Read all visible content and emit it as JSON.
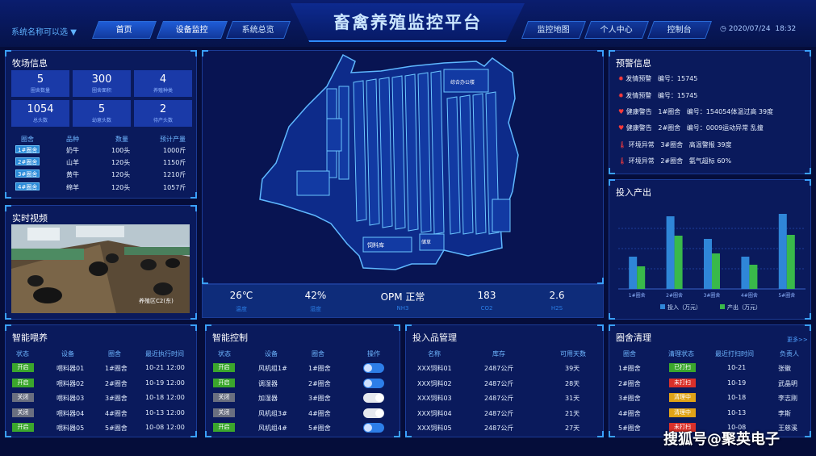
{
  "header": {
    "title": "畜禽养殖监控平台",
    "system_name": "系统名称可以选",
    "datetime_date": "2020/07/24",
    "datetime_time": "18:32",
    "nav_left": [
      "首页",
      "设备监控",
      "系统总览"
    ],
    "nav_right": [
      "监控地图",
      "个人中心",
      "控制台"
    ]
  },
  "farm_info": {
    "title": "牧场信息",
    "stats": [
      {
        "value": "5",
        "label": "圈舍数量"
      },
      {
        "value": "300",
        "label": "圈舍面积"
      },
      {
        "value": "4",
        "label": "养殖种类"
      },
      {
        "value": "1054",
        "label": "总头数"
      },
      {
        "value": "5",
        "label": "幼崽头数"
      },
      {
        "value": "2",
        "label": "待产头数"
      }
    ],
    "columns": [
      "圈舍",
      "品种",
      "数量",
      "预计产量"
    ],
    "rows": [
      [
        "1#圈舍",
        "奶牛",
        "100头",
        "1000斤"
      ],
      [
        "2#圈舍",
        "山羊",
        "120头",
        "1150斤"
      ],
      [
        "3#圈舍",
        "黄牛",
        "120头",
        "1210斤"
      ],
      [
        "4#圈舍",
        "绵羊",
        "120头",
        "1057斤"
      ]
    ]
  },
  "video": {
    "title": "实时视频",
    "overlay": "养殖区C2(东)"
  },
  "map_labels": {
    "label1": "综合办公楼",
    "label2": "储草",
    "label3": "饲料库"
  },
  "sensors": [
    {
      "value": "26℃",
      "label": "温度"
    },
    {
      "value": "42%",
      "label": "湿度"
    },
    {
      "value": "OPM 正常",
      "label": "NH3"
    },
    {
      "value": "183",
      "label": "CO2"
    },
    {
      "value": "2.6",
      "label": "H2S"
    }
  ],
  "alerts": {
    "title": "预警信息",
    "rows": [
      {
        "type": "发情预警",
        "detail": "编号：15745",
        "extra": ""
      },
      {
        "type": "发情预警",
        "detail": "编号：15745",
        "extra": ""
      },
      {
        "type": "健康警告",
        "detail": "1#圈舍",
        "extra": "编号：154054体温过高  39度"
      },
      {
        "type": "健康警告",
        "detail": "2#圈舍",
        "extra": "编号：0009运动异常  乱撞"
      },
      {
        "type": "环境异常",
        "detail": "3#圈舍",
        "extra": "高温警报        39度"
      },
      {
        "type": "环境异常",
        "detail": "2#圈舍",
        "extra": "氨气超标        60%"
      }
    ]
  },
  "chart_data": {
    "type": "bar",
    "title": "投入产出",
    "categories": [
      "1#圈舍",
      "2#圈舍",
      "3#圈舍",
      "4#圈舍",
      "5#圈舍"
    ],
    "series": [
      {
        "name": "投入（万元）",
        "values": [
          40,
          90,
          62,
          40,
          93
        ],
        "color": "#2f86d8"
      },
      {
        "name": "产出（万元）",
        "values": [
          28,
          66,
          44,
          30,
          67
        ],
        "color": "#39b94a"
      }
    ],
    "ylim": [
      0,
      100
    ],
    "legend": "bottom"
  },
  "feeding": {
    "title": "智能喂养",
    "columns": [
      "状态",
      "设备",
      "圈舍",
      "最近执行时间"
    ],
    "rows": [
      {
        "status": "开启",
        "on": true,
        "device": "喂料器01",
        "pen": "1#圈舍",
        "time": "10-21  12:00"
      },
      {
        "status": "开启",
        "on": true,
        "device": "喂料器02",
        "pen": "2#圈舍",
        "time": "10-19  12:00"
      },
      {
        "status": "关闭",
        "on": false,
        "device": "喂料器03",
        "pen": "3#圈舍",
        "time": "10-18  12:00"
      },
      {
        "status": "关闭",
        "on": false,
        "device": "喂料器04",
        "pen": "4#圈舍",
        "time": "10-13  12:00"
      },
      {
        "status": "开启",
        "on": true,
        "device": "喂料器05",
        "pen": "5#圈舍",
        "time": "10-08  12:00"
      }
    ]
  },
  "control": {
    "title": "智能控制",
    "columns": [
      "状态",
      "设备",
      "圈舍",
      "操作"
    ],
    "rows": [
      {
        "status": "开启",
        "on": true,
        "device": "风机组1#",
        "pen": "1#圈舍"
      },
      {
        "status": "开启",
        "on": true,
        "device": "调湿器",
        "pen": "2#圈舍"
      },
      {
        "status": "关闭",
        "on": false,
        "device": "加湿器",
        "pen": "3#圈舍"
      },
      {
        "status": "关闭",
        "on": false,
        "device": "风机组3#",
        "pen": "4#圈舍"
      },
      {
        "status": "开启",
        "on": true,
        "device": "风机组4#",
        "pen": "5#圈舍"
      }
    ]
  },
  "inputs": {
    "title": "投入品管理",
    "columns": [
      "名称",
      "库存",
      "可用天数"
    ],
    "rows": [
      [
        "XXX饲料01",
        "2487公斤",
        "39天"
      ],
      [
        "XXX饲料02",
        "2487公斤",
        "28天"
      ],
      [
        "XXX饲料03",
        "2487公斤",
        "31天"
      ],
      [
        "XXX饲料04",
        "2487公斤",
        "21天"
      ],
      [
        "XXX饲料05",
        "2487公斤",
        "27天"
      ]
    ]
  },
  "cleaning": {
    "title": "圈舍清理",
    "more": "更多>>",
    "columns": [
      "圈舍",
      "清理状态",
      "最近打扫时间",
      "负责人"
    ],
    "rows": [
      {
        "pen": "1#圈舍",
        "status": "已打扫",
        "color": "#3ba72c",
        "time": "10-21",
        "person": "张徽"
      },
      {
        "pen": "2#圈舍",
        "status": "未打扫",
        "color": "#d9302a",
        "time": "10-19",
        "person": "武晶明"
      },
      {
        "pen": "3#圈舍",
        "status": "清理中",
        "color": "#e0a317",
        "time": "10-18",
        "person": "李志刚"
      },
      {
        "pen": "4#圈舍",
        "status": "清理中",
        "color": "#e0a317",
        "time": "10-13",
        "person": "李斯"
      },
      {
        "pen": "5#圈舍",
        "status": "未打扫",
        "color": "#d9302a",
        "time": "10-08",
        "person": "王慈溪"
      }
    ]
  },
  "watermark": "搜狐号@聚英电子"
}
